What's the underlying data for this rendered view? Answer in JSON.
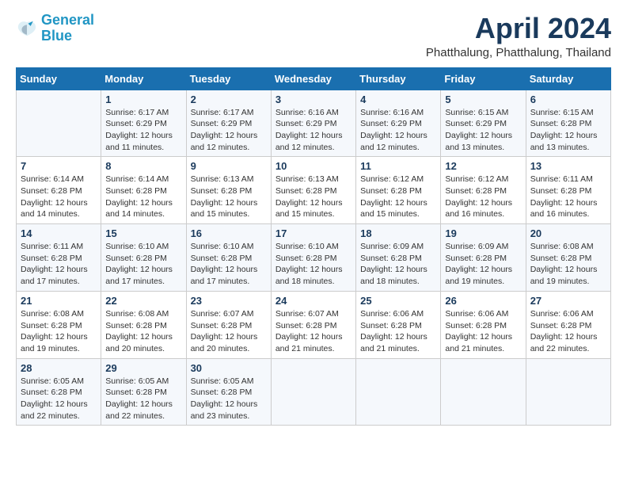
{
  "header": {
    "logo_line1": "General",
    "logo_line2": "Blue",
    "month": "April 2024",
    "location": "Phatthalung, Phatthalung, Thailand"
  },
  "days_of_week": [
    "Sunday",
    "Monday",
    "Tuesday",
    "Wednesday",
    "Thursday",
    "Friday",
    "Saturday"
  ],
  "weeks": [
    [
      {
        "day": "",
        "info": ""
      },
      {
        "day": "1",
        "info": "Sunrise: 6:17 AM\nSunset: 6:29 PM\nDaylight: 12 hours\nand 11 minutes."
      },
      {
        "day": "2",
        "info": "Sunrise: 6:17 AM\nSunset: 6:29 PM\nDaylight: 12 hours\nand 12 minutes."
      },
      {
        "day": "3",
        "info": "Sunrise: 6:16 AM\nSunset: 6:29 PM\nDaylight: 12 hours\nand 12 minutes."
      },
      {
        "day": "4",
        "info": "Sunrise: 6:16 AM\nSunset: 6:29 PM\nDaylight: 12 hours\nand 12 minutes."
      },
      {
        "day": "5",
        "info": "Sunrise: 6:15 AM\nSunset: 6:29 PM\nDaylight: 12 hours\nand 13 minutes."
      },
      {
        "day": "6",
        "info": "Sunrise: 6:15 AM\nSunset: 6:28 PM\nDaylight: 12 hours\nand 13 minutes."
      }
    ],
    [
      {
        "day": "7",
        "info": "Sunrise: 6:14 AM\nSunset: 6:28 PM\nDaylight: 12 hours\nand 14 minutes."
      },
      {
        "day": "8",
        "info": "Sunrise: 6:14 AM\nSunset: 6:28 PM\nDaylight: 12 hours\nand 14 minutes."
      },
      {
        "day": "9",
        "info": "Sunrise: 6:13 AM\nSunset: 6:28 PM\nDaylight: 12 hours\nand 15 minutes."
      },
      {
        "day": "10",
        "info": "Sunrise: 6:13 AM\nSunset: 6:28 PM\nDaylight: 12 hours\nand 15 minutes."
      },
      {
        "day": "11",
        "info": "Sunrise: 6:12 AM\nSunset: 6:28 PM\nDaylight: 12 hours\nand 15 minutes."
      },
      {
        "day": "12",
        "info": "Sunrise: 6:12 AM\nSunset: 6:28 PM\nDaylight: 12 hours\nand 16 minutes."
      },
      {
        "day": "13",
        "info": "Sunrise: 6:11 AM\nSunset: 6:28 PM\nDaylight: 12 hours\nand 16 minutes."
      }
    ],
    [
      {
        "day": "14",
        "info": "Sunrise: 6:11 AM\nSunset: 6:28 PM\nDaylight: 12 hours\nand 17 minutes."
      },
      {
        "day": "15",
        "info": "Sunrise: 6:10 AM\nSunset: 6:28 PM\nDaylight: 12 hours\nand 17 minutes."
      },
      {
        "day": "16",
        "info": "Sunrise: 6:10 AM\nSunset: 6:28 PM\nDaylight: 12 hours\nand 17 minutes."
      },
      {
        "day": "17",
        "info": "Sunrise: 6:10 AM\nSunset: 6:28 PM\nDaylight: 12 hours\nand 18 minutes."
      },
      {
        "day": "18",
        "info": "Sunrise: 6:09 AM\nSunset: 6:28 PM\nDaylight: 12 hours\nand 18 minutes."
      },
      {
        "day": "19",
        "info": "Sunrise: 6:09 AM\nSunset: 6:28 PM\nDaylight: 12 hours\nand 19 minutes."
      },
      {
        "day": "20",
        "info": "Sunrise: 6:08 AM\nSunset: 6:28 PM\nDaylight: 12 hours\nand 19 minutes."
      }
    ],
    [
      {
        "day": "21",
        "info": "Sunrise: 6:08 AM\nSunset: 6:28 PM\nDaylight: 12 hours\nand 19 minutes."
      },
      {
        "day": "22",
        "info": "Sunrise: 6:08 AM\nSunset: 6:28 PM\nDaylight: 12 hours\nand 20 minutes."
      },
      {
        "day": "23",
        "info": "Sunrise: 6:07 AM\nSunset: 6:28 PM\nDaylight: 12 hours\nand 20 minutes."
      },
      {
        "day": "24",
        "info": "Sunrise: 6:07 AM\nSunset: 6:28 PM\nDaylight: 12 hours\nand 21 minutes."
      },
      {
        "day": "25",
        "info": "Sunrise: 6:06 AM\nSunset: 6:28 PM\nDaylight: 12 hours\nand 21 minutes."
      },
      {
        "day": "26",
        "info": "Sunrise: 6:06 AM\nSunset: 6:28 PM\nDaylight: 12 hours\nand 21 minutes."
      },
      {
        "day": "27",
        "info": "Sunrise: 6:06 AM\nSunset: 6:28 PM\nDaylight: 12 hours\nand 22 minutes."
      }
    ],
    [
      {
        "day": "28",
        "info": "Sunrise: 6:05 AM\nSunset: 6:28 PM\nDaylight: 12 hours\nand 22 minutes."
      },
      {
        "day": "29",
        "info": "Sunrise: 6:05 AM\nSunset: 6:28 PM\nDaylight: 12 hours\nand 22 minutes."
      },
      {
        "day": "30",
        "info": "Sunrise: 6:05 AM\nSunset: 6:28 PM\nDaylight: 12 hours\nand 23 minutes."
      },
      {
        "day": "",
        "info": ""
      },
      {
        "day": "",
        "info": ""
      },
      {
        "day": "",
        "info": ""
      },
      {
        "day": "",
        "info": ""
      }
    ]
  ]
}
